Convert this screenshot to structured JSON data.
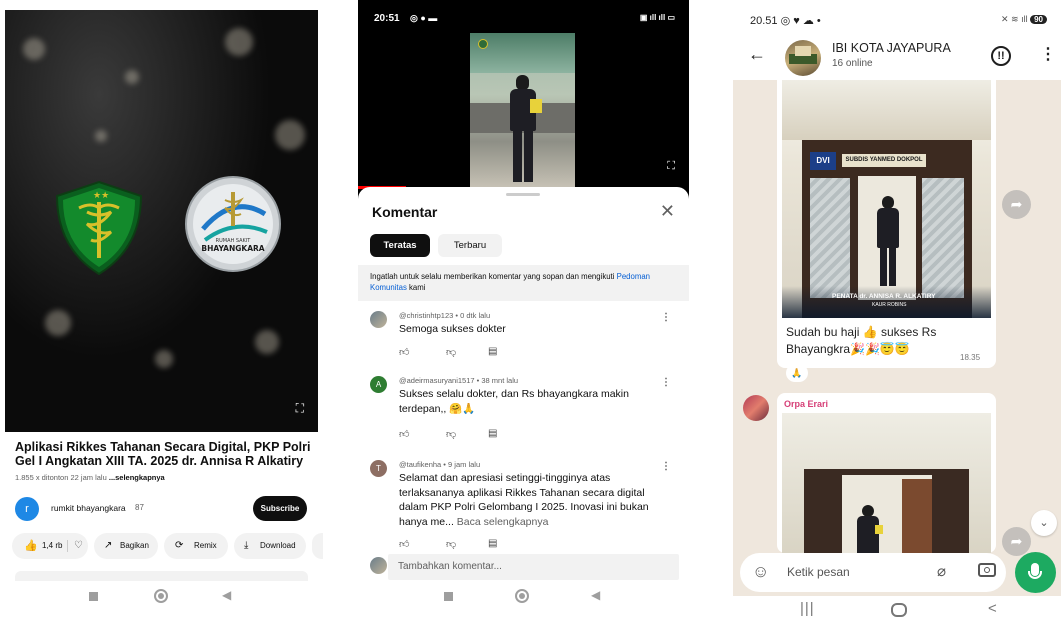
{
  "youtube": {
    "title": "Aplikasi Rikkes Tahanan Secara Digital, PKP Polri Gel I Angkatan XIII TA. 2025 dr. Annisa R Alkatiry",
    "views": "1.855 x ditonton",
    "age": "22 jam lalu",
    "more": "...selengkapnya",
    "channel_initial": "r",
    "channel_name": "rumkit bhayangkara",
    "subs": "87",
    "subscribe": "Subscribe",
    "likes": "1,4 rb",
    "share": "Bagikan",
    "remix": "Remix",
    "download": "Download",
    "emblem2_text": "RUMAH SAKIT BHAYANGKARA"
  },
  "shorts": {
    "status_time": "20:51",
    "comments_title": "Komentar",
    "chip_top": "Teratas",
    "chip_new": "Terbaru",
    "notice_text": "Ingatlah untuk selalu memberikan komentar yang sopan dan mengikuti",
    "notice_link": "Pedoman Komunitas",
    "notice_end": "kami",
    "comments": [
      {
        "user": "@christinhtp123 • 0 dtk lalu",
        "text": "Semoga sukses dokter",
        "avatar": ""
      },
      {
        "user": "@adeirmasuryani1517 • 38 mnt lalu",
        "text": "Sukses selalu dokter,  dan Rs bhayangkara makin terdepan,, 🤗🙏",
        "avatar": "A"
      },
      {
        "user": "@taufikenha • 9 jam lalu",
        "text": "Selamat dan apresiasi setinggi-tingginya atas terlaksananya aplikasi Rikkes Tahanan secara digital dalam PKP Polri Gelombang I 2025. Inovasi ini bukan hanya me...",
        "more": "Baca selengkapnya",
        "avatar": "T"
      }
    ],
    "add_comment_placeholder": "Tambahkan komentar..."
  },
  "whatsapp": {
    "status_time": "20.51",
    "battery": "90",
    "group_name": "IBI KOTA JAYAPURA",
    "group_sub": "16 online",
    "image_banner": "SUBDIS YANMED DOKPOL",
    "image_caption": "PENATA dr. ANNISA R. ALKATIRY",
    "image_caption_sub": "KAUR ROBINS",
    "message": "Sudah bu haji 👍 sukses Rs Bhayangkra🎉🎉😇😇",
    "message_time": "18.35",
    "reaction": "🙏",
    "sender": "Orpa Erari",
    "input_placeholder": "Ketik pesan"
  },
  "colors": {
    "yt_red": "#ff0000",
    "wa_green": "#1daa61",
    "link_blue": "#065fd4"
  }
}
